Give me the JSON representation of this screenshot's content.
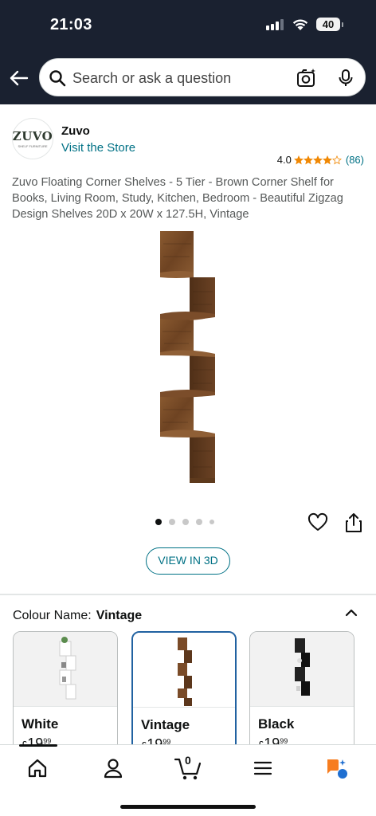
{
  "status_bar": {
    "time": "21:03",
    "battery": "40"
  },
  "header": {
    "search_placeholder": "Search or ask a question",
    "icons": [
      "back-arrow-icon",
      "search-icon",
      "camera-icon",
      "mic-icon"
    ]
  },
  "brand": {
    "logo_text": "ZUVO",
    "logo_subtext": "SHELF FURNITURE",
    "name": "Zuvo",
    "store_link": "Visit the Store"
  },
  "rating": {
    "value": "4.0",
    "stars": 4,
    "count": "(86)",
    "star_color": "#f08804"
  },
  "product": {
    "title": "Zuvo Floating Corner Shelves - 5 Tier - Brown Corner Shelf for Books, Living Room, Study, Kitchen, Bedroom - Beautiful Zigzag Design Shelves 20D x 20W x 127.5H, Vintage",
    "image_count": 5,
    "active_image": 1,
    "view_3d_label": "VIEW IN 3D"
  },
  "variations": {
    "label": "Colour Name:",
    "selected": "Vintage",
    "options": [
      {
        "name": "White",
        "price_symbol": "£",
        "price_whole": "19",
        "price_fraction": "99"
      },
      {
        "name": "Vintage",
        "price_symbol": "£",
        "price_whole": "19",
        "price_fraction": "99"
      },
      {
        "name": "Black",
        "price_symbol": "£",
        "price_whole": "19",
        "price_fraction": "99"
      }
    ]
  },
  "bottom_nav": {
    "cart_count": "0",
    "items": [
      "home-icon",
      "account-icon",
      "cart-icon",
      "menu-icon",
      "rufus-ai-icon"
    ]
  },
  "colors": {
    "header_bg": "#1a2130",
    "link": "#007185",
    "selected_border": "#2162a1",
    "wood": "#7a4b28"
  }
}
